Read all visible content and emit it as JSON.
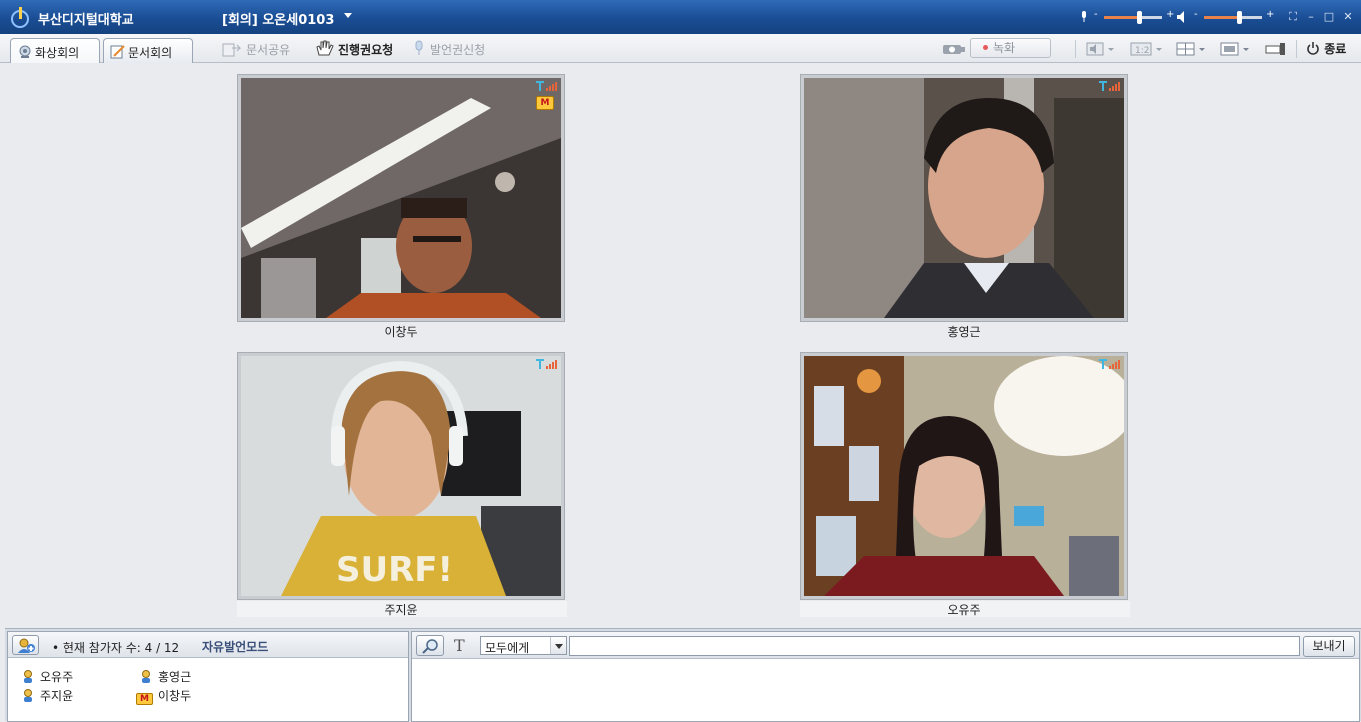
{
  "titlebar": {
    "app_title": "부산디지털대학교",
    "room_title": "[회의] 오온세0103",
    "mic_minus": "-",
    "mic_plus": "+",
    "spk_minus": "-",
    "spk_plus": "+",
    "mic_level": 0.62,
    "speaker_level": 0.62
  },
  "tabs": [
    {
      "label": "화상회의",
      "icon": "video-conference-icon",
      "active": true
    },
    {
      "label": "문서회의",
      "icon": "document-conference-icon",
      "active": false
    }
  ],
  "toolbar": {
    "share_doc": "문서공유",
    "request_progress": "진행권요청",
    "request_speak": "발언권신청",
    "record": "녹화",
    "exit": "종료"
  },
  "videos": [
    {
      "name": "이창두",
      "host_badge": "M"
    },
    {
      "name": "홍영근"
    },
    {
      "name": "주지윤"
    },
    {
      "name": "오유주"
    }
  ],
  "participants": {
    "count_text": "• 현재 참가자 수: 4 / 12",
    "mode": "자유발언모드",
    "list": [
      {
        "name": "오유주",
        "icon": "user-icon"
      },
      {
        "name": "홍영근",
        "icon": "user-icon"
      },
      {
        "name": "주지윤",
        "icon": "user-icon"
      },
      {
        "name": "이창두",
        "icon": "host-icon",
        "badge": "M"
      }
    ]
  },
  "chat": {
    "target": "모두에게",
    "input_value": "",
    "send": "보내기"
  },
  "colors": {
    "titlebar": "#1a4d94",
    "accent": "#e9814b",
    "mode_text": "#3a4f79"
  }
}
